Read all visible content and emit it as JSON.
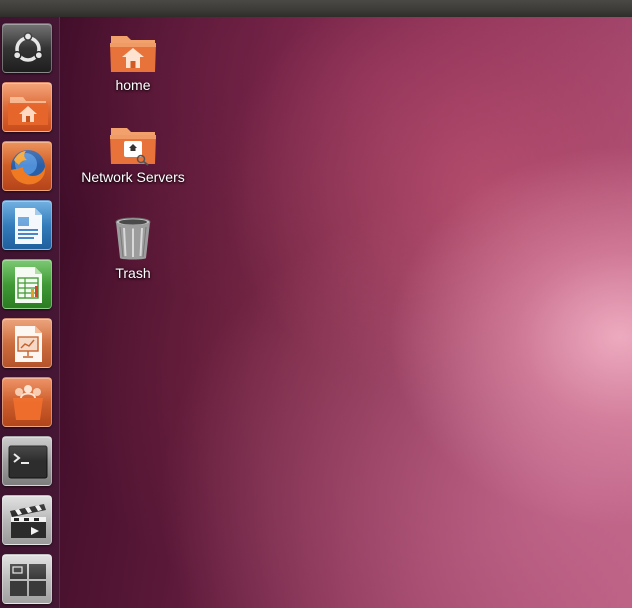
{
  "desktop": {
    "icons": [
      {
        "label": "home",
        "icon": "home-folder-icon"
      },
      {
        "label": "Network Servers",
        "icon": "network-folder-icon"
      },
      {
        "label": "Trash",
        "icon": "trash-icon"
      }
    ]
  },
  "launcher": {
    "items": [
      {
        "icon": "ubuntu-dash-icon"
      },
      {
        "icon": "home-folder-icon"
      },
      {
        "icon": "firefox-icon"
      },
      {
        "icon": "libreoffice-writer-icon"
      },
      {
        "icon": "libreoffice-calc-icon"
      },
      {
        "icon": "libreoffice-impress-icon"
      },
      {
        "icon": "software-center-icon"
      },
      {
        "icon": "terminal-icon"
      },
      {
        "icon": "video-editor-icon"
      },
      {
        "icon": "workspace-switcher-icon"
      }
    ]
  },
  "colors": {
    "launcher_bg": "#421531",
    "panel_bg": "#3c3b37",
    "folder_orange": "#e8733a"
  }
}
